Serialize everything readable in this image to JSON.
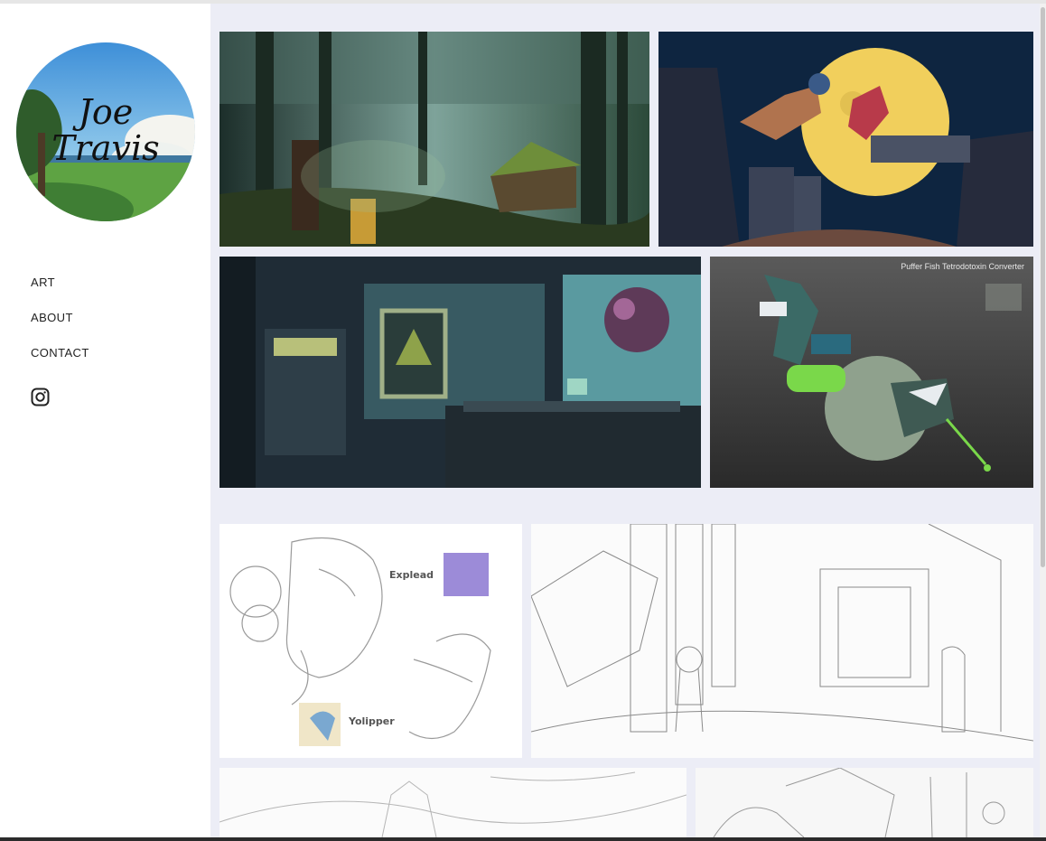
{
  "branding": {
    "name_line1": "Joe",
    "name_line2": "Travis"
  },
  "nav": {
    "items": [
      {
        "label": "ART"
      },
      {
        "label": "ABOUT"
      },
      {
        "label": "CONTACT"
      }
    ]
  },
  "social": {
    "icon": "instagram-icon"
  },
  "gallery": {
    "row1": [
      {
        "name": "forest-cabin-painting"
      },
      {
        "name": "moonlit-robots-render"
      }
    ],
    "row2": [
      {
        "name": "lab-interior-painting"
      },
      {
        "name": "puffer-fish-converter-render",
        "caption": "Puffer Fish Tetrodotoxin Converter"
      }
    ],
    "row3": [
      {
        "name": "creature-sketch-sheet",
        "label_a": "Explead",
        "label_b": "Yolipper"
      },
      {
        "name": "temple-corridor-sketch"
      }
    ],
    "row4": [
      {
        "name": "ziggurat-landscape-sketch"
      },
      {
        "name": "harbor-sketch"
      }
    ]
  },
  "colors": {
    "page_bg": "#ecedf6",
    "sidebar_bg": "#ffffff",
    "text": "#222222"
  }
}
